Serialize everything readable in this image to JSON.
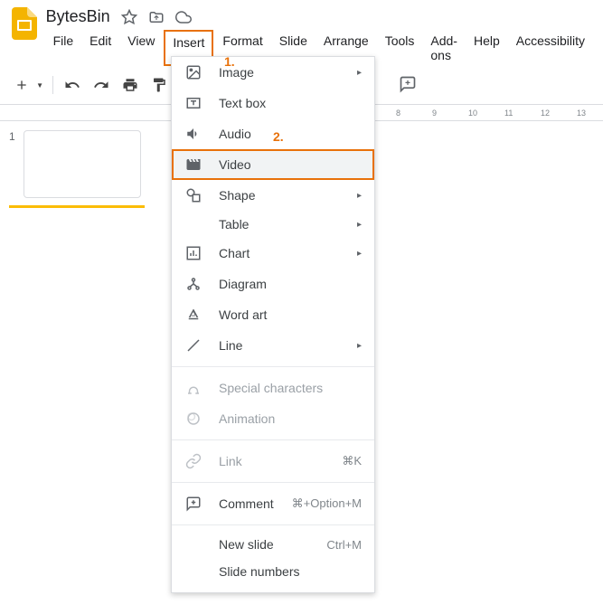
{
  "header": {
    "title": "BytesBin"
  },
  "menubar": {
    "items": [
      "File",
      "Edit",
      "View",
      "Insert",
      "Format",
      "Slide",
      "Arrange",
      "Tools",
      "Add-ons",
      "Help",
      "Accessibility"
    ],
    "active_index": 3
  },
  "annotations": {
    "a1": "1.",
    "a2": "2."
  },
  "ruler": {
    "ticks": [
      "8",
      "9",
      "10",
      "11",
      "12",
      "13"
    ]
  },
  "slides": {
    "current": "1"
  },
  "dropdown": {
    "items": [
      {
        "icon": "image",
        "label": "Image",
        "submenu": true
      },
      {
        "icon": "textbox",
        "label": "Text box"
      },
      {
        "icon": "audio",
        "label": "Audio"
      },
      {
        "icon": "video",
        "label": "Video",
        "highlighted": true
      },
      {
        "icon": "shape",
        "label": "Shape",
        "submenu": true
      },
      {
        "icon": "",
        "label": "Table",
        "submenu": true
      },
      {
        "icon": "chart",
        "label": "Chart",
        "submenu": true
      },
      {
        "icon": "diagram",
        "label": "Diagram"
      },
      {
        "icon": "wordart",
        "label": "Word art"
      },
      {
        "icon": "line",
        "label": "Line",
        "submenu": true
      },
      {
        "divider": true
      },
      {
        "icon": "special",
        "label": "Special characters",
        "disabled": true
      },
      {
        "icon": "animation",
        "label": "Animation",
        "disabled": true
      },
      {
        "divider": true
      },
      {
        "icon": "link",
        "label": "Link",
        "shortcut": "⌘K",
        "disabled": true
      },
      {
        "divider": true
      },
      {
        "icon": "comment",
        "label": "Comment",
        "shortcut": "⌘+Option+M"
      },
      {
        "divider": true
      },
      {
        "icon": "",
        "label": "New slide",
        "shortcut": "Ctrl+M"
      },
      {
        "icon": "",
        "label": "Slide numbers"
      }
    ]
  }
}
